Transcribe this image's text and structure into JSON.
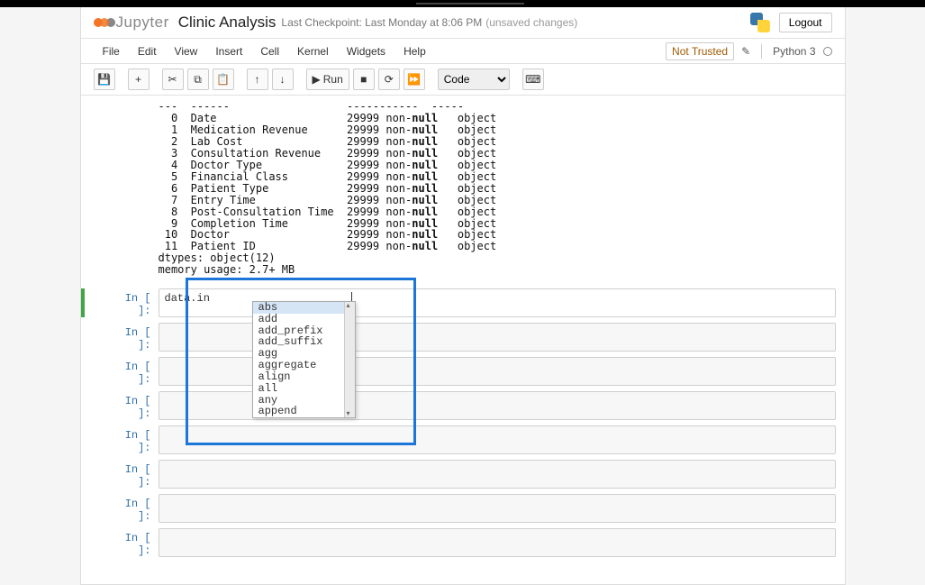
{
  "header": {
    "logo_text": "Jupyter",
    "notebook_title": "Clinic Analysis",
    "checkpoint": "Last Checkpoint: Last Monday at 8:06 PM",
    "unsaved": "(unsaved changes)",
    "logout": "Logout"
  },
  "menubar": {
    "items": [
      "File",
      "Edit",
      "View",
      "Insert",
      "Cell",
      "Kernel",
      "Widgets",
      "Help"
    ],
    "not_trusted": "Not Trusted",
    "kernel": "Python 3"
  },
  "toolbar": {
    "run_label": "Run",
    "cell_type_selected": "Code"
  },
  "output": {
    "sep_row": "---  ------                  -----------  -----",
    "columns": [
      {
        "i": "0",
        "name": "Date",
        "count": "29999 non-null",
        "dtype": "object"
      },
      {
        "i": "1",
        "name": "Medication Revenue",
        "count": "29999 non-null",
        "dtype": "object"
      },
      {
        "i": "2",
        "name": "Lab Cost",
        "count": "29999 non-null",
        "dtype": "object"
      },
      {
        "i": "3",
        "name": "Consultation Revenue",
        "count": "29999 non-null",
        "dtype": "object"
      },
      {
        "i": "4",
        "name": "Doctor Type",
        "count": "29999 non-null",
        "dtype": "object"
      },
      {
        "i": "5",
        "name": "Financial Class",
        "count": "29999 non-null",
        "dtype": "object"
      },
      {
        "i": "6",
        "name": "Patient Type",
        "count": "29999 non-null",
        "dtype": "object"
      },
      {
        "i": "7",
        "name": "Entry Time",
        "count": "29999 non-null",
        "dtype": "object"
      },
      {
        "i": "8",
        "name": "Post-Consultation Time",
        "count": "29999 non-null",
        "dtype": "object"
      },
      {
        "i": "9",
        "name": "Completion Time",
        "count": "29999 non-null",
        "dtype": "object"
      },
      {
        "i": "10",
        "name": "Doctor",
        "count": "29999 non-null",
        "dtype": "object"
      },
      {
        "i": "11",
        "name": "Patient ID",
        "count": "29999 non-null",
        "dtype": "object"
      }
    ],
    "dtypes_line": "dtypes: object(12)",
    "memory_line": "memory usage: 2.7+ MB"
  },
  "active_cell": {
    "prompt": "In [ ]:",
    "content": "data.in"
  },
  "empty_prompt": "In [ ]:",
  "autocomplete": {
    "items": [
      "abs",
      "add",
      "add_prefix",
      "add_suffix",
      "agg",
      "aggregate",
      "align",
      "all",
      "any",
      "append"
    ],
    "selected_index": 0
  }
}
